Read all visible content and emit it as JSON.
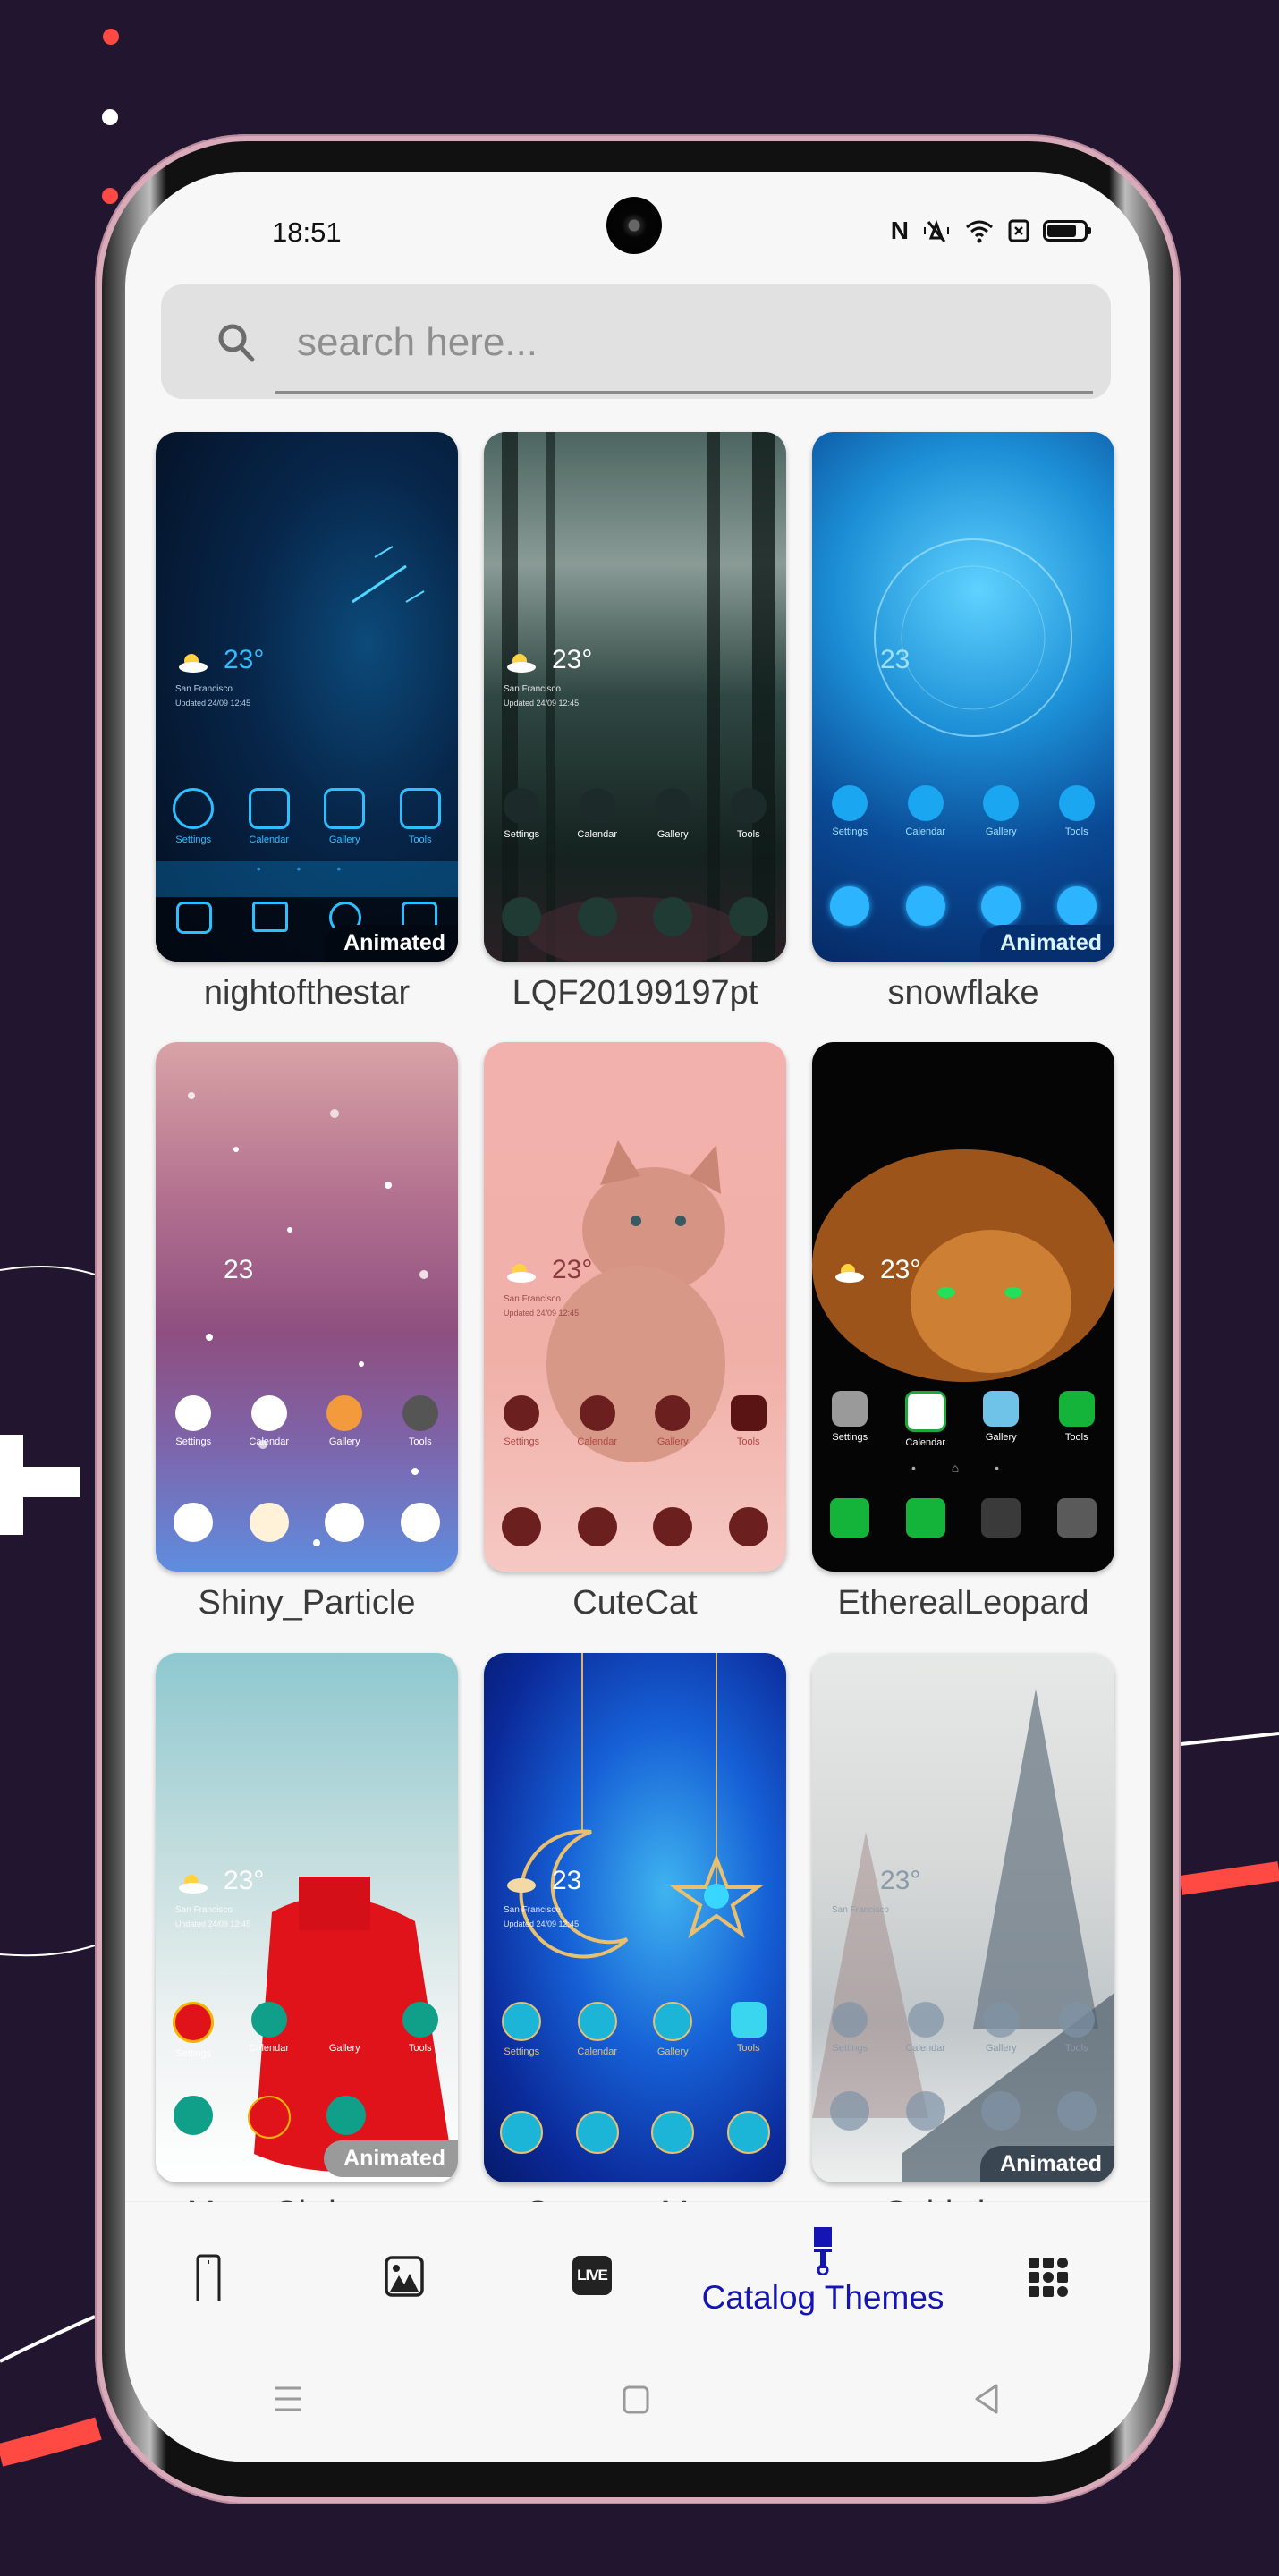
{
  "status_bar": {
    "time": "18:51",
    "icons": [
      "nfc-icon",
      "vibrate-icon",
      "wifi-icon",
      "sim-none-icon",
      "battery-icon"
    ]
  },
  "search": {
    "placeholder": "search here...",
    "value": "",
    "icon": "search-icon"
  },
  "themes": [
    {
      "name": "nightofthestar",
      "animated": true,
      "badge": "Animated",
      "temp": "23°",
      "location": "San Francisco",
      "updated": "Updated 24/09 12:45",
      "apps": [
        "Settings",
        "Calendar",
        "Gallery",
        "Tools"
      ]
    },
    {
      "name": "LQF20199197pt",
      "animated": false,
      "badge": "",
      "temp": "23°",
      "location": "San Francisco",
      "updated": "Updated 24/09 12:45",
      "apps": [
        "Settings",
        "Calendar",
        "Gallery",
        "Tools"
      ]
    },
    {
      "name": "snowflake",
      "animated": true,
      "badge": "Animated",
      "temp": "23",
      "location": "",
      "updated": "",
      "apps": [
        "Settings",
        "Calendar",
        "Gallery",
        "Tools"
      ]
    },
    {
      "name": "Shiny_Particle",
      "animated": false,
      "badge": "",
      "temp": "23",
      "location": "",
      "updated": "",
      "apps": [
        "Settings",
        "Calendar",
        "Gallery",
        "Tools"
      ]
    },
    {
      "name": "CuteCat",
      "animated": false,
      "badge": "",
      "temp": "23°",
      "location": "San Francisco",
      "updated": "Updated 24/09 12:45",
      "apps": [
        "Settings",
        "Calendar",
        "Gallery",
        "Tools"
      ]
    },
    {
      "name": "EtherealLeopard",
      "animated": false,
      "badge": "",
      "temp": "23°",
      "location": "",
      "updated": "",
      "apps": [
        "Settings",
        "Calendar",
        "Gallery",
        "Tools"
      ]
    },
    {
      "name": "MerryChristmas",
      "animated": true,
      "badge": "Animated",
      "temp": "23°",
      "location": "San Francisco",
      "updated": "Updated 24/09 12:45",
      "apps": [
        "Settings",
        "Calendar",
        "Gallery",
        "Tools"
      ]
    },
    {
      "name": "CrescentMoon",
      "animated": false,
      "badge": "",
      "temp": "23",
      "location": "San Francisco",
      "updated": "Updated 24/09 12:45",
      "apps": [
        "Settings",
        "Calendar",
        "Gallery",
        "Tools"
      ]
    },
    {
      "name": "Coldwinter",
      "animated": true,
      "badge": "Animated",
      "temp": "23°",
      "location": "San Francisco",
      "updated": "",
      "apps": [
        "Settings",
        "Calendar",
        "Gallery",
        "Tools"
      ]
    }
  ],
  "bottom_nav": {
    "items": [
      {
        "id": "phone",
        "icon": "phone-outline-icon",
        "label": "",
        "active": false
      },
      {
        "id": "wallpapers",
        "icon": "image-icon",
        "label": "",
        "active": false
      },
      {
        "id": "live",
        "icon": "live-icon",
        "label": "",
        "icon_text": "LIVE",
        "active": false
      },
      {
        "id": "catalog-themes",
        "icon": "paint-brush-icon",
        "label": "Catalog Themes",
        "active": true
      },
      {
        "id": "more",
        "icon": "grid-icon",
        "label": "",
        "active": false
      }
    ],
    "active_color": "#1515b5"
  },
  "system_nav": [
    "recents-icon",
    "home-icon",
    "back-icon"
  ]
}
